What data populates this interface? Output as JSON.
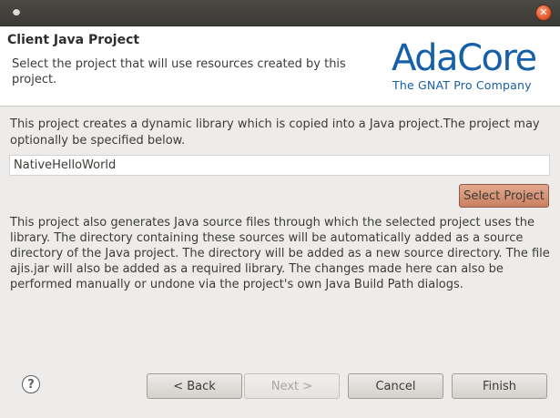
{
  "window": {
    "close_glyph": "✕"
  },
  "header": {
    "title": "Client Java Project",
    "description": "Select the project that will use resources created by this project.",
    "logo": {
      "brand": "AdaCore",
      "tagline": "The GNAT Pro Company"
    }
  },
  "body": {
    "intro_text": "This project creates a dynamic library which is copied into a Java project.The project may optionally be specified below.",
    "project_field": {
      "value": "NativeHelloWorld"
    },
    "select_button_label": "Select Project",
    "details_text": "This project also generates Java source files through which the selected project uses the library. The directory containing these sources will be automatically added as a source directory of the Java project. The directory will be added as a new source directory. The file ajis.jar will also be added as a required library. The changes made here can also be performed manually or undone via the project's own Java Build Path dialogs."
  },
  "footer": {
    "help_glyph": "?",
    "back_label": "< Back",
    "next_label": "Next >",
    "cancel_label": "Cancel",
    "finish_label": "Finish"
  },
  "colors": {
    "titlebar": "#3c3b37",
    "accent_button": "#c98060",
    "logo_blue": "#1560a8",
    "background": "#edeceb"
  }
}
